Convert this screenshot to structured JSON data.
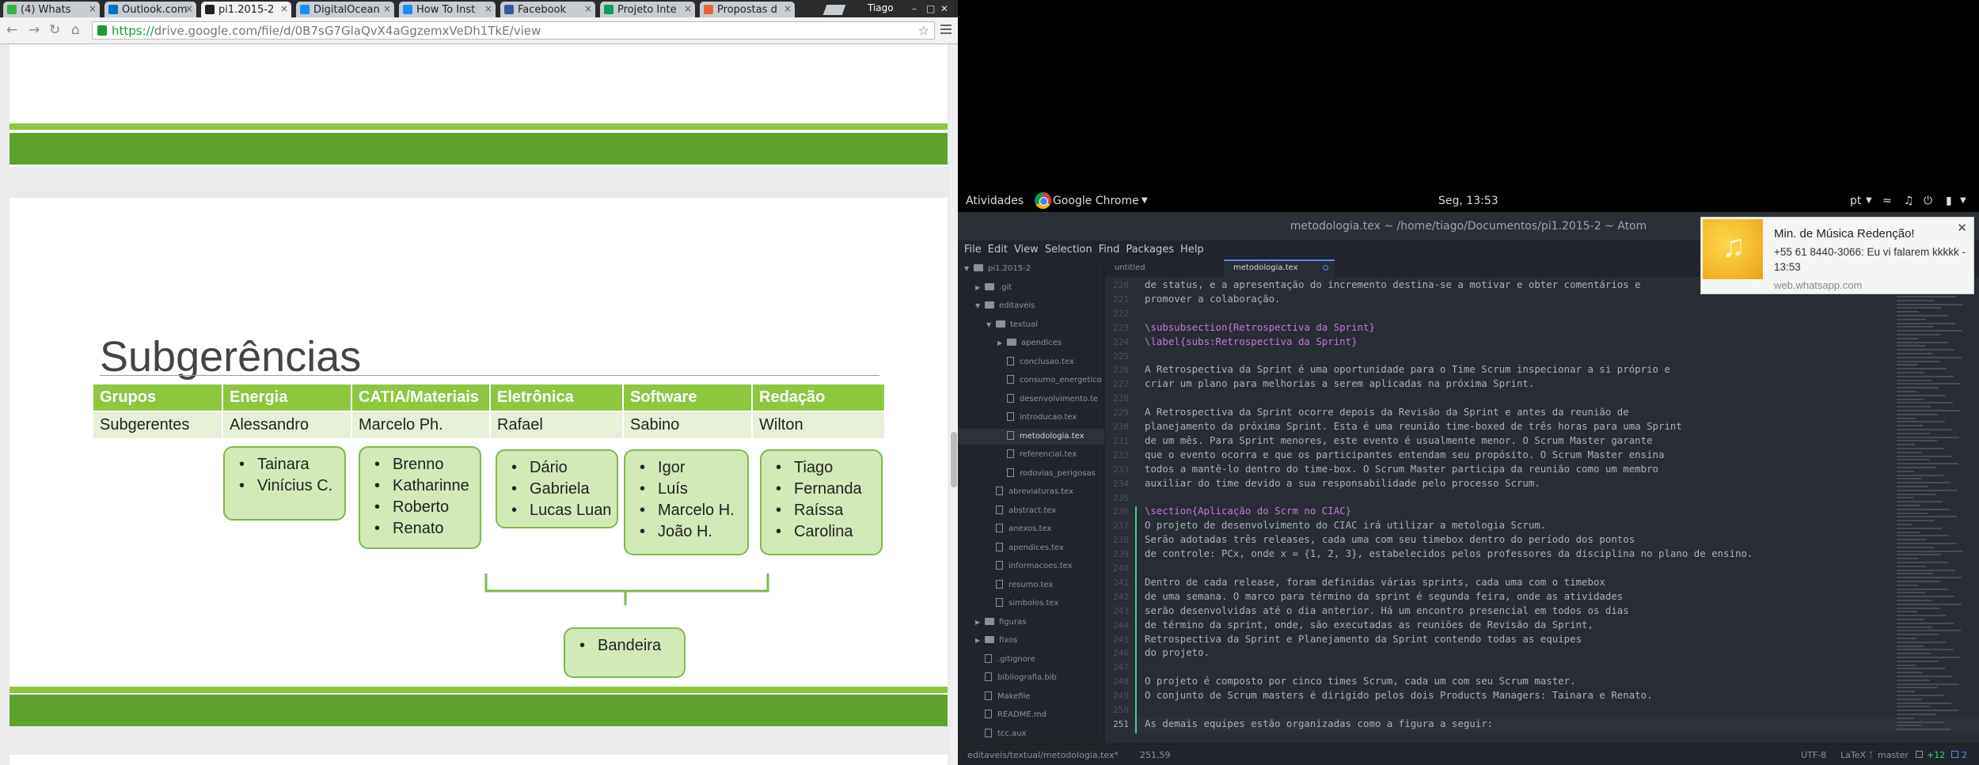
{
  "chrome": {
    "tabs": [
      {
        "label": "(4) Whats",
        "color": "#2fb344"
      },
      {
        "label": "Outlook.com",
        "color": "#0072c6"
      },
      {
        "label": "pi1.2015-2",
        "color": "#222222"
      },
      {
        "label": "DigitalOcean",
        "color": "#1a8cff"
      },
      {
        "label": "How To Inst",
        "color": "#1a8cff"
      },
      {
        "label": "Facebook",
        "color": "#3b5998"
      },
      {
        "label": "Projeto Inte",
        "color": "#0f9d58"
      },
      {
        "label": "Propostas d",
        "color": "#e8643c"
      }
    ],
    "profile": "Tiago",
    "url_scheme": "https://",
    "url_rest": "drive.google.com/file/d/0B7sG7GlaQvX4aGgzemxVeDh1TkE/view"
  },
  "slide": {
    "title": "Subgerências",
    "headers": [
      "Grupos",
      "Energia",
      "CATIA/Materiais",
      "Eletrônica",
      "Software",
      "Redação"
    ],
    "row": [
      "Subgerentes",
      "Alessandro",
      "Marcelo Ph.",
      "Rafael",
      "Sabino",
      "Wilton"
    ],
    "groups": [
      [
        "Tainara",
        "Vinícius C."
      ],
      [
        "Brenno",
        "Katharinne",
        "Roberto",
        "Renato"
      ],
      [
        "Dário",
        "Gabriela",
        "Lucas Luan"
      ],
      [
        "Igor",
        "Luís",
        "Marcelo H.",
        "João H."
      ],
      [
        "Tiago",
        "Fernanda",
        "Raíssa",
        "Carolina"
      ]
    ],
    "bottom_box": [
      "Bandeira"
    ],
    "accent": "#8dc63f",
    "dark_accent": "#5fa12f"
  },
  "gnome": {
    "activities": "Atividades",
    "app": "Google Chrome",
    "clock": "Seg, 13:53",
    "lang": "pt"
  },
  "atom": {
    "title": "metodologia.tex ~ /home/tiago/Documentos/pi1.2015-2 ~ Atom",
    "menu": [
      "File",
      "Edit",
      "View",
      "Selection",
      "Find",
      "Packages",
      "Help"
    ],
    "tabs": [
      "untitled",
      "metodologia.tex"
    ],
    "tree": [
      {
        "label": "pi1.2015-2",
        "kind": "dir-open",
        "indent": 0
      },
      {
        "label": ".git",
        "kind": "dir",
        "indent": 1
      },
      {
        "label": "editaveis",
        "kind": "dir-open",
        "indent": 1
      },
      {
        "label": "textual",
        "kind": "dir-open",
        "indent": 2
      },
      {
        "label": "apendices",
        "kind": "dir",
        "indent": 3
      },
      {
        "label": "conclusao.tex",
        "kind": "file",
        "indent": 3
      },
      {
        "label": "consumo_energetico",
        "kind": "file",
        "indent": 3
      },
      {
        "label": "desenvolvimento.te",
        "kind": "file",
        "indent": 3
      },
      {
        "label": "introducao.tex",
        "kind": "file",
        "indent": 3
      },
      {
        "label": "metodologia.tex",
        "kind": "file",
        "indent": 3,
        "selected": true
      },
      {
        "label": "referencial.tex",
        "kind": "file",
        "indent": 3
      },
      {
        "label": "rodovias_perigosas",
        "kind": "file",
        "indent": 3
      },
      {
        "label": "abreviaturas.tex",
        "kind": "file",
        "indent": 2
      },
      {
        "label": "abstract.tex",
        "kind": "file",
        "indent": 2
      },
      {
        "label": "anexos.tex",
        "kind": "file",
        "indent": 2
      },
      {
        "label": "apendices.tex",
        "kind": "file",
        "indent": 2
      },
      {
        "label": "informacoes.tex",
        "kind": "file",
        "indent": 2
      },
      {
        "label": "resumo.tex",
        "kind": "file",
        "indent": 2
      },
      {
        "label": "simbolos.tex",
        "kind": "file",
        "indent": 2
      },
      {
        "label": "figuras",
        "kind": "dir",
        "indent": 1
      },
      {
        "label": "fixos",
        "kind": "dir",
        "indent": 1
      },
      {
        "label": ".gitignore",
        "kind": "file",
        "indent": 1
      },
      {
        "label": "bibliografia.bib",
        "kind": "file",
        "indent": 1
      },
      {
        "label": "Makefile",
        "kind": "file",
        "indent": 1
      },
      {
        "label": "README.md",
        "kind": "file",
        "indent": 1
      },
      {
        "label": "tcc.aux",
        "kind": "file",
        "indent": 1
      }
    ],
    "lines": [
      {
        "n": "220",
        "t": "de status, e a apresentação do incremento destina-se a motivar e obter comentários e"
      },
      {
        "n": "221",
        "t": "promover a colaboração."
      },
      {
        "n": "222",
        "t": ""
      },
      {
        "n": "223",
        "t": "\\subsubsection{Retrospectiva da Sprint}",
        "cmd": true
      },
      {
        "n": "224",
        "t": "\\label{subs:Retrospectiva da Sprint}",
        "cmd": true
      },
      {
        "n": "225",
        "t": ""
      },
      {
        "n": "226",
        "t": "A Retrospectiva da Sprint é uma oportunidade para o Time Scrum inspecionar a si próprio e"
      },
      {
        "n": "227",
        "t": "criar um plano para melhorias a serem aplicadas na próxima Sprint."
      },
      {
        "n": "228",
        "t": ""
      },
      {
        "n": "229",
        "t": "A Retrospectiva da Sprint ocorre depois da Revisão da Sprint e antes da reunião de"
      },
      {
        "n": "230",
        "t": "planejamento da próxima Sprint. Esta é uma reunião time-boxed de três horas para uma Sprint"
      },
      {
        "n": "231",
        "t": "de um mês. Para Sprint menores, este evento é usualmente menor. O Scrum Master garante"
      },
      {
        "n": "232",
        "t": "que o evento ocorra e que os participantes entendam seu propósito. O Scrum Master ensina"
      },
      {
        "n": "233",
        "t": "todos a mantê-lo dentro do time-box. O Scrum Master participa da reunião como um membro"
      },
      {
        "n": "234",
        "t": "auxiliar do time devido a sua responsabilidade pelo processo Scrum."
      },
      {
        "n": "235",
        "t": ""
      },
      {
        "n": "236",
        "t": "\\section{Aplicação do Scrm no CIAC}",
        "cmd": true
      },
      {
        "n": "237",
        "t": "O projeto de desenvolvimento do CIAC irá utilizar a metologia Scrum."
      },
      {
        "n": "238",
        "t": "Serão adotadas três releases, cada uma com seu timebox dentro do período dos pontos"
      },
      {
        "n": "239",
        "t": "de controle: PCx, onde x = {1, 2, 3}, estabelecidos pelos professores da disciplina no plano de ensino."
      },
      {
        "n": "240",
        "t": ""
      },
      {
        "n": "241",
        "t": "Dentro de cada release, foram definidas várias sprints, cada uma com o timebox"
      },
      {
        "n": "242",
        "t": "de uma semana. O marco para término da sprint é segunda feira, onde as atividades"
      },
      {
        "n": "243",
        "t": "serão desenvolvidas até o dia anterior. Há um encontro presencial em todos os dias"
      },
      {
        "n": "244",
        "t": "de término da sprint, onde, são executadas as reuniões de Revisão da Sprint,"
      },
      {
        "n": "245",
        "t": "Retrospectiva da Sprint e Planejamento da Sprint contendo todas as equipes"
      },
      {
        "n": "246",
        "t": "do projeto."
      },
      {
        "n": "247",
        "t": ""
      },
      {
        "n": "248",
        "t": "O projeto é composto por cinco times Scrum, cada um com seu Scrum master."
      },
      {
        "n": "249",
        "t": "O conjunto de Scrum masters é dirigido pelos dois Products Managers: Tainara e Renato."
      },
      {
        "n": "250",
        "t": ""
      },
      {
        "n": "251",
        "t": "As demais equipes estão organizadas como a figura a seguir:"
      }
    ],
    "current_line": 31,
    "status": {
      "file": "editaveis/textual/metodologia.tex*",
      "cursor": "251,59",
      "encoding": "UTF-8",
      "grammar": "LaTeX",
      "branch": "master",
      "diff": "+12",
      "updates": "2"
    }
  },
  "notification": {
    "title": "Min. de Música Redenção!",
    "body": "+55 61 8440-3066: Eu vi falarem kkkkk - 13:53",
    "source": "web.whatsapp.com"
  }
}
